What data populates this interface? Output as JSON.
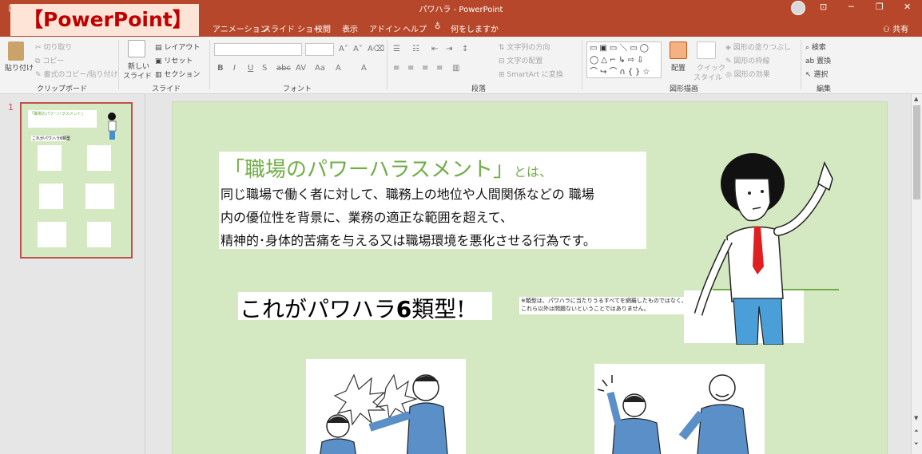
{
  "window": {
    "title": "パワハラ - PowerPoint",
    "overlay_label": "【PowerPoint】",
    "share_label": "共有"
  },
  "tabs": [
    "アニメーション",
    "スライド ショー",
    "校閲",
    "表示",
    "アドイン",
    "ヘルプ"
  ],
  "tell_me": "何をしますか",
  "ribbon": {
    "clipboard": {
      "label": "クリップボード",
      "paste": "貼り付け",
      "cut": "切り取り",
      "copy": "コピー",
      "format_painter": "書式のコピー/貼り付け"
    },
    "slides": {
      "label": "スライド",
      "new_slide_1": "新しい",
      "new_slide_2": "スライド",
      "layout": "レイアウト",
      "reset": "リセット",
      "section": "セクション"
    },
    "font": {
      "label": "フォント"
    },
    "paragraph": {
      "label": "段落",
      "text_direction": "文字列の方向",
      "align_text": "文字の配置",
      "smartart": "SmartArt に変換"
    },
    "drawing": {
      "label": "図形描画",
      "arrange": "配置",
      "quick_styles_1": "クイック",
      "quick_styles_2": "スタイル",
      "shape_fill": "図形の塗りつぶし",
      "shape_outline": "図形の枠線",
      "shape_effects": "図形の効果"
    },
    "editing": {
      "label": "編集",
      "find": "検索",
      "replace": "置換",
      "select": "選択"
    }
  },
  "thumbnail": {
    "number": "1",
    "title": "「職場のパワーハラスメント」",
    "subtitle": "これがパワハラ6類型"
  },
  "slide": {
    "heading": "「職場のパワーハラスメント」",
    "heading_suffix": "とは、",
    "body_lines": [
      "同じ職場で働く者に対して、職務上の地位や人間関係などの 職場",
      "内の優位性を背景に、業務の適正な範囲を超えて、",
      "精神的･身体的苦痛を与える又は職場環境を悪化させる行為です。"
    ],
    "six_types_pre": "これがパワハラ",
    "six_types_num": "6",
    "six_types_post": "類型!",
    "note_lines": [
      "※類型は、パワハラに当たりうるすべてを網羅したものではなく、",
      "これら以外は問題ないということではありません。"
    ]
  },
  "colors": {
    "accent": "#b7472a",
    "slide_bg": "#d4e9c2",
    "heading_green": "#70ad47",
    "label_red": "#c00000"
  }
}
